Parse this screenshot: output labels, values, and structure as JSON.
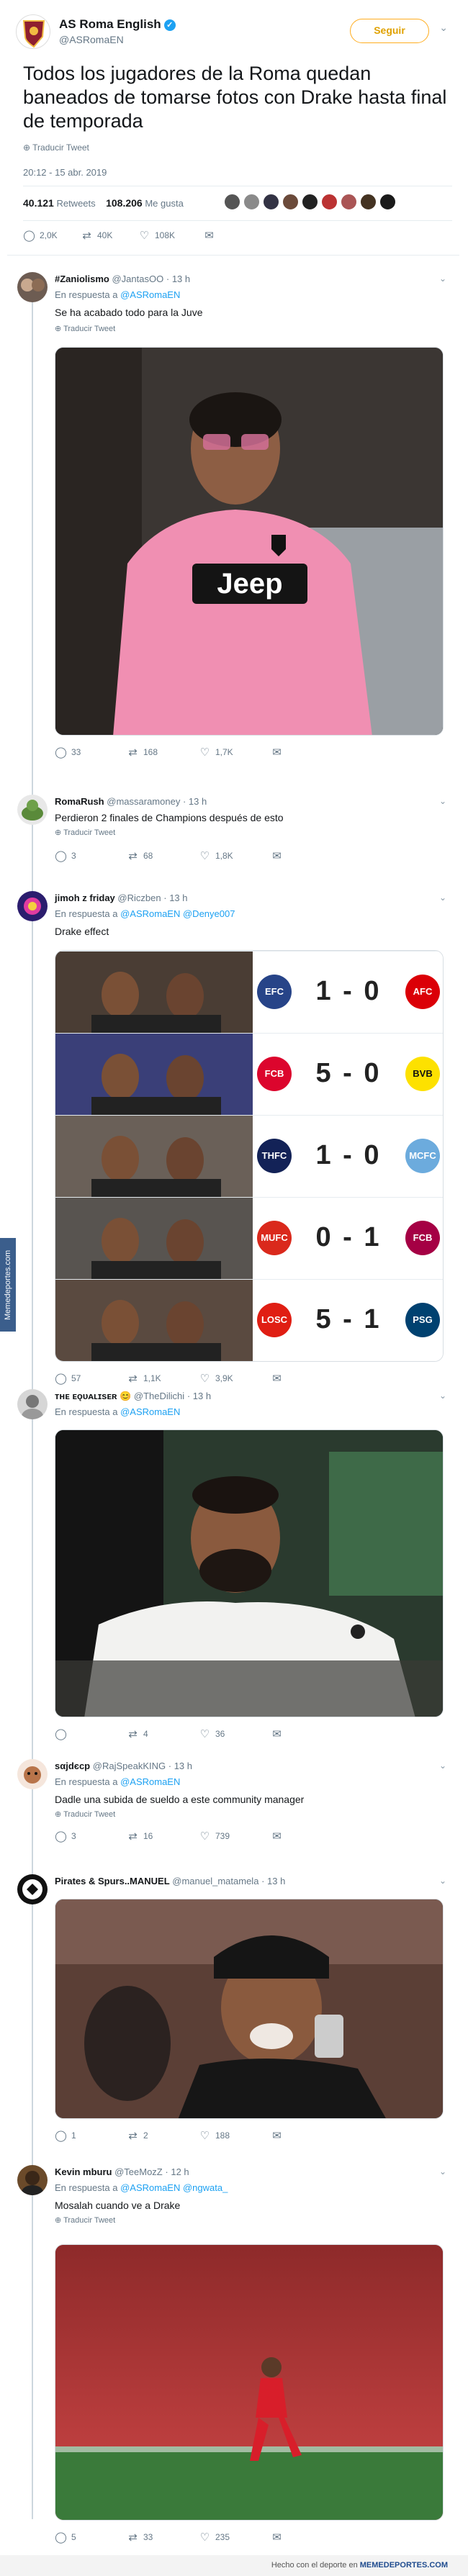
{
  "main_tweet": {
    "name": "AS Roma English",
    "handle": "@ASRomaEN",
    "follow_label": "Seguir",
    "text": "Todos los jugadores de la Roma quedan baneados de tomarse fotos con Drake hasta final de temporada",
    "translate_label": "Traducir Tweet",
    "date": "20:12 - 15 abr. 2019",
    "retweets_count": "40.121",
    "retweets_label": "Retweets",
    "likes_count": "108.206",
    "likes_label": "Me gusta",
    "actions": {
      "replies": "2,0K",
      "retweets": "40K",
      "likes": "108K"
    }
  },
  "replies": [
    {
      "name": "#Zaniolismo",
      "handle": "@JantasOO",
      "time": "13 h",
      "in_reply_label": "En respuesta a",
      "mention": "@ASRomaEN",
      "text": "Se ha acabado todo para la Juve",
      "translate_label": "Traducir Tweet",
      "counts": {
        "replies": "33",
        "retweets": "168",
        "likes": "1,7K"
      },
      "media_text": "Jeep"
    },
    {
      "name": "RomaRush",
      "handle": "@massaramoney",
      "time": "13 h",
      "text": "Perdieron 2 finales de Champions después de esto",
      "translate_label": "Traducir Tweet",
      "counts": {
        "replies": "3",
        "retweets": "68",
        "likes": "1,8K"
      }
    },
    {
      "name": "jimoh z friday",
      "handle": "@Riczben",
      "time": "13 h",
      "in_reply_label": "En respuesta a",
      "mention": "@ASRomaEN",
      "mention2": "@Denye007",
      "text": "Drake effect",
      "counts": {
        "replies": "57",
        "retweets": "1,1K",
        "likes": "3,9K"
      }
    },
    {
      "name": "ᴛʜᴇ ᴇǫᴜᴀʟɪsᴇʀ",
      "handle": "@TheDilichi",
      "time": "13 h",
      "in_reply_label": "En respuesta a",
      "mention": "@ASRomaEN",
      "counts": {
        "replies": "",
        "retweets": "4",
        "likes": "36"
      }
    },
    {
      "name": "ѕαjdєcp",
      "handle": "@RajSpeakKING",
      "time": "13 h",
      "in_reply_label": "En respuesta a",
      "mention": "@ASRomaEN",
      "text": "Dadle una subida de sueldo a este community manager",
      "translate_label": "Traducir Tweet",
      "counts": {
        "replies": "3",
        "retweets": "16",
        "likes": "739"
      }
    },
    {
      "name": "Pirates & Spurs..MANUEL",
      "handle": "@manuel_matamela",
      "time": "13 h",
      "counts": {
        "replies": "1",
        "retweets": "2",
        "likes": "188"
      }
    },
    {
      "name": "Kevin mburu",
      "handle": "@TeeMozZ",
      "time": "12 h",
      "in_reply_label": "En respuesta a",
      "mention": "@ASRomaEN",
      "mention2": "@ngwata_",
      "text": "Mosalah cuando ve a Drake",
      "translate_label": "Traducir Tweet",
      "counts": {
        "replies": "5",
        "retweets": "33",
        "likes": "235"
      }
    }
  ],
  "scores": [
    {
      "score": "1 - 0",
      "home": "EFC",
      "away": "AFC",
      "home_color": "#274488",
      "away_color": "#db0007"
    },
    {
      "score": "5 - 0",
      "home": "FCB",
      "away": "BVB",
      "home_color": "#dc052d",
      "away_color": "#fde100"
    },
    {
      "score": "1 - 0",
      "home": "THFC",
      "away": "MCFC",
      "home_color": "#132257",
      "away_color": "#6cabdd"
    },
    {
      "score": "0 - 1",
      "home": "MUFC",
      "away": "FCB",
      "home_color": "#da291c",
      "away_color": "#a50044"
    },
    {
      "score": "5 - 1",
      "home": "LOSC",
      "away": "PSG",
      "home_color": "#e01e13",
      "away_color": "#004170"
    }
  ],
  "watermark": "Memedeportes.com",
  "footer": {
    "prefix": "Hecho con el deporte en",
    "brand": "MEMEDEPORTES.COM"
  },
  "colors": {
    "accent": "#1da1f2",
    "follow": "#ffad1f"
  }
}
